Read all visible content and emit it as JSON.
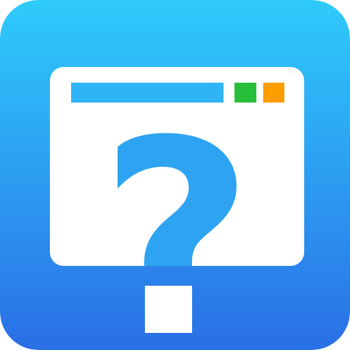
{
  "icon": {
    "name": "unknown-window-help-icon",
    "glyph": "?",
    "colors": {
      "gradient_top": "#2ecbfb",
      "gradient_bottom": "#2a6fe6",
      "window_fill": "#ffffff",
      "titlebar_fill": "#2fb5f6",
      "green_button": "#28c03a",
      "orange_button": "#ff9c00",
      "question_mark": "#2ea3f2",
      "question_dot": "#ffffff"
    }
  }
}
